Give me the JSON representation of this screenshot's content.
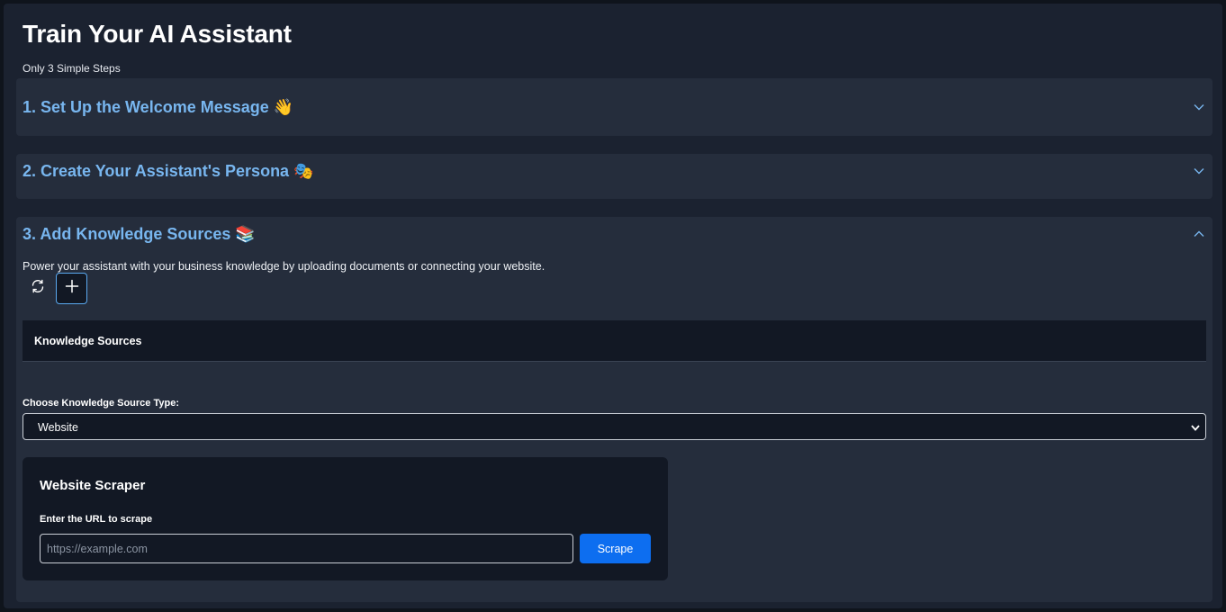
{
  "header": {
    "title": "Train Your AI Assistant",
    "subtitle": "Only 3 Simple Steps"
  },
  "steps": [
    {
      "title": "1. Set Up the Welcome Message 👋",
      "expanded": false
    },
    {
      "title": "2. Create Your Assistant's Persona 🎭",
      "expanded": false
    },
    {
      "title": "3. Add Knowledge Sources 📚",
      "expanded": true
    }
  ],
  "knowledge": {
    "description": "Power your assistant with your business knowledge by uploading documents or connecting your website.",
    "refresh_icon": "refresh-icon",
    "add_icon": "plus-icon",
    "table_header": "Knowledge Sources",
    "source_type_label": "Choose Knowledge Source Type:",
    "source_type_value": "Website",
    "scraper": {
      "title": "Website Scraper",
      "url_label": "Enter the URL to scrape",
      "url_placeholder": "https://example.com",
      "url_value": "",
      "button_label": "Scrape"
    }
  },
  "colors": {
    "accent": "#78b6ef",
    "primary_button": "#0d6ef0",
    "panel": "#252d3c",
    "background": "#1b2230"
  }
}
